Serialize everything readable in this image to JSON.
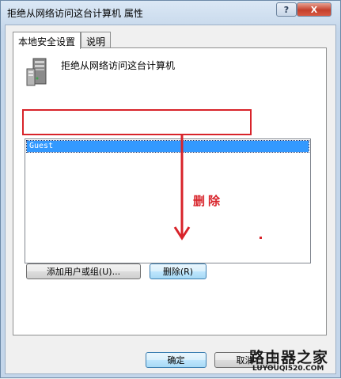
{
  "window": {
    "title": "拒绝从网络访问这台计算机 属性",
    "help_label": "?",
    "close_label": "X"
  },
  "tabs": [
    {
      "label": "本地安全设置",
      "active": true
    },
    {
      "label": "说明",
      "active": false
    }
  ],
  "policy": {
    "icon": "server-icon",
    "name": "拒绝从网络访问这台计算机"
  },
  "list": {
    "items": [
      {
        "label": "Guest",
        "selected": true
      }
    ]
  },
  "buttons": {
    "add": "添加用户或组(U)...",
    "remove": "删除(R)",
    "ok": "确定",
    "cancel": "取消"
  },
  "annotation": {
    "text": "删除",
    "color": "#d8232a"
  },
  "watermark": {
    "cn": "路由器之家",
    "en": "LUYOUQI520.COM"
  },
  "colors": {
    "selection": "#3399ff",
    "annotation": "#d8232a",
    "title_gradient_top": "#dbe8f5"
  }
}
